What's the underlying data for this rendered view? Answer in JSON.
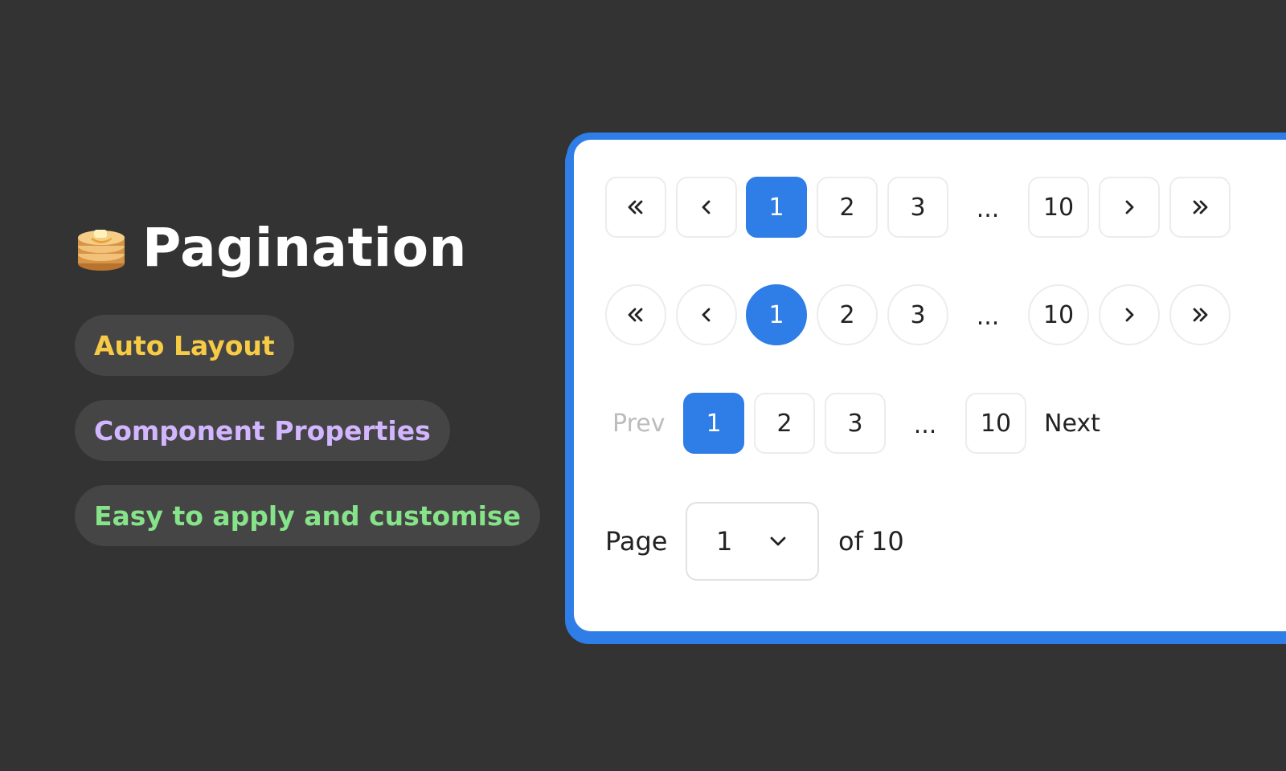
{
  "header": {
    "title": "Pagination",
    "icon": "pancakes-icon"
  },
  "tags": [
    {
      "label": "Auto Layout",
      "color": "#f7cb45"
    },
    {
      "label": "Component Properties",
      "color": "#d2b6ff"
    },
    {
      "label": "Easy to apply and customise",
      "color": "#86e389"
    }
  ],
  "accent_color": "#2f7de6",
  "pagination_square": {
    "pages": [
      "1",
      "2",
      "3",
      "10"
    ],
    "ellipsis": "...",
    "current": "1"
  },
  "pagination_round": {
    "pages": [
      "1",
      "2",
      "3",
      "10"
    ],
    "ellipsis": "...",
    "current": "1"
  },
  "pagination_text": {
    "prev_label": "Prev",
    "next_label": "Next",
    "pages": [
      "1",
      "2",
      "3",
      "10"
    ],
    "ellipsis": "...",
    "current": "1"
  },
  "page_select": {
    "page_label": "Page",
    "selected": "1",
    "of_label": "of 10"
  }
}
